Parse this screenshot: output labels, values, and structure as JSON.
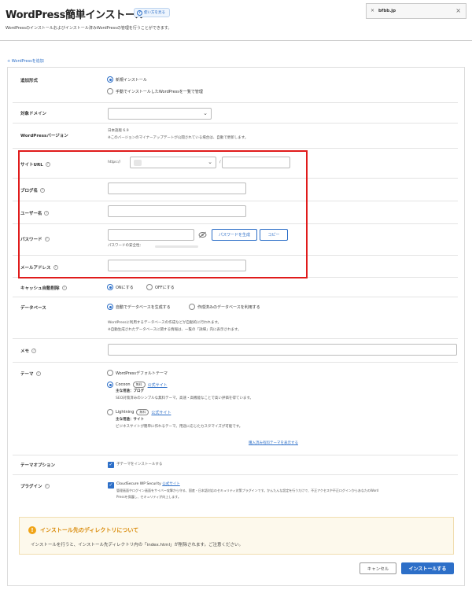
{
  "header": {
    "title": "WordPress簡単インストール",
    "howto_label": "使い方を見る",
    "subtitle": "WordPressのインストールおよびインストール済みWordPressの管理を行うことができます。",
    "domain_tab": "bfbb.jp"
  },
  "add_wordpress_link": "+ WordPressを追加",
  "form": {
    "install_type": {
      "label": "追加形式",
      "options": [
        "新規インストール",
        "手動でインストールしたWordPressを一覧で管理"
      ]
    },
    "domain": {
      "label": "対象ドメイン"
    },
    "wp_version": {
      "label": "WordPressバージョン",
      "value": "日本語版 6.9",
      "note": "※このバージョンのマイナーアップデートが公開されている場合は、自動で更新します。"
    },
    "site_url": {
      "label": "サイトURL",
      "prefix": "https://",
      "separator": "/"
    },
    "blog_name": {
      "label": "ブログ名"
    },
    "username": {
      "label": "ユーザー名"
    },
    "password": {
      "label": "パスワード",
      "generate_label": "パスワードを生成",
      "copy_label": "コピー",
      "strength_label": "パスワードの安全性："
    },
    "email": {
      "label": "メールアドレス"
    },
    "cache": {
      "label": "キャッシュ自動削除",
      "on_label": "ONにする",
      "off_label": "OFFにする"
    },
    "database": {
      "label": "データベース",
      "options": [
        "自動でデータベースを生成する",
        "作成済みのデータベースを利用する"
      ],
      "note1": "WordPressに利用するデータベースの作成などが自動的に行われます。",
      "note2": "※自動生成されたデータベースに関する情報は、一覧の「詳細」内に表示されます。"
    },
    "memo": {
      "label": "メモ"
    },
    "theme": {
      "label": "テーマ",
      "default_option": "WordPressデフォルトテーマ",
      "cocoon": {
        "name": "Cocoon",
        "badge": "無料",
        "site_link": "公式サイト",
        "recommend": "主な用途：ブログ",
        "desc": "SEO対策済みのシンプルな無料テーマ。高速・高機能なことで高い評価を得ています。"
      },
      "lightning": {
        "name": "Lightning",
        "badge": "無料",
        "site_link": "公式サイト",
        "recommend": "主な用途：サイト",
        "desc": "ビジネスサイトが簡単に作れるテーマ。用途に応じたカスタマイズが可能です。"
      },
      "paid_link": "購入済み有料テーマを表示する"
    },
    "theme_option": {
      "label": "テーマオプション",
      "checkbox_label": "子テーマをインストールする"
    },
    "plugin": {
      "label": "プラグイン",
      "name": "CloudSecure WP Security",
      "site_link": "公式サイト",
      "desc1": "管理画面やログイン画面をサイバー攻撃から守る、国産・日本語対応のセキュリティ対策プラグインです。かんたんな設定を行うだけで、不正アクセスや不正ログインからあなたのWord",
      "desc2": "Pressを保護し、セキュリティが向上します。"
    }
  },
  "notice": {
    "title": "インストール先のディレクトリについて",
    "body": "インストールを行うと、インストール先ディレクトリ内の「index.html」が削除されます。ご注意ください。"
  },
  "buttons": {
    "cancel": "キャンセル",
    "install": "インストールする"
  },
  "colors": {
    "accent": "#2d6fc8",
    "highlight_border": "#e01b1b",
    "notice_bg": "#fdf9ec",
    "notice_title": "#d98a08"
  }
}
